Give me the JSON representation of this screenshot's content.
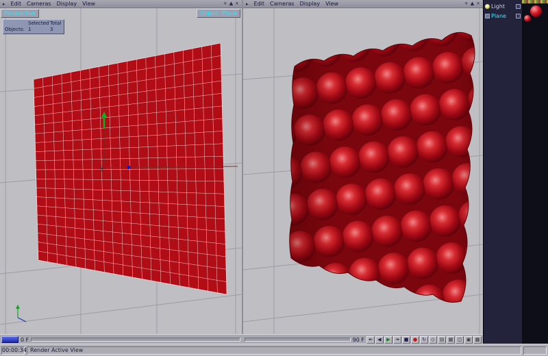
{
  "colors": {
    "plane_red": "#b10d16",
    "bump_valley": "#7c060e",
    "selection_cyan": "#3fe8ff",
    "timeline_blue": "#2a3ec0"
  },
  "icons": {
    "panel_menu": "▸",
    "pan": "+",
    "maximize": "▲",
    "close": "×"
  },
  "left_viewport": {
    "menu_items": [
      "Edit",
      "Cameras",
      "Display",
      "View"
    ],
    "view_label": "Perspective",
    "object_label": "Object",
    "object_value": "Plane",
    "stats": {
      "col_selected": "Selected",
      "col_total": "Total",
      "row_label": "Objects:",
      "selected_count": "1",
      "total_count": "3"
    },
    "frame_label": "0 F"
  },
  "right_viewport": {
    "menu_items": [
      "Edit",
      "Cameras",
      "Display",
      "View"
    ],
    "frame_label": "90 F"
  },
  "playback_buttons": [
    {
      "name": "first-frame",
      "glyph": "↞",
      "color": "#1c1c4e"
    },
    {
      "name": "step-back",
      "glyph": "◀",
      "color": "#1c1c4e"
    },
    {
      "name": "play",
      "glyph": "▶",
      "color": "#0b7a12"
    },
    {
      "name": "step-forward",
      "glyph": "↠",
      "color": "#1c1c4e"
    },
    {
      "name": "stop",
      "glyph": "■",
      "color": "#1c1c4e"
    },
    {
      "name": "record",
      "glyph": "●",
      "color": "#c01212"
    },
    {
      "name": "loop",
      "glyph": "↻",
      "color": "#1c1c4e"
    },
    {
      "name": "keyframe",
      "glyph": "◇",
      "color": "#1c1c4e"
    },
    {
      "name": "view-mode-1",
      "glyph": "▤",
      "color": "#34343c"
    },
    {
      "name": "view-mode-2",
      "glyph": "▦",
      "color": "#34343c"
    },
    {
      "name": "view-mode-3",
      "glyph": "◫",
      "color": "#34343c"
    },
    {
      "name": "view-mode-4",
      "glyph": "▣",
      "color": "#34343c"
    },
    {
      "name": "view-mode-5",
      "glyph": "▩",
      "color": "#34343c"
    }
  ],
  "scene_tree": {
    "items": [
      {
        "label": "Light",
        "color": "#cdd2e2"
      },
      {
        "label": "Plane",
        "color": "#3fe8ff"
      }
    ]
  },
  "status_bar": {
    "time": "00:00:34",
    "message": "Render Active View"
  }
}
